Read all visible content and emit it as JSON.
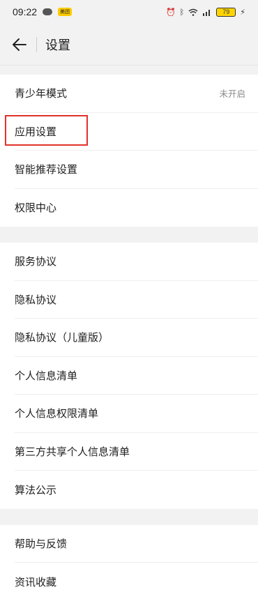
{
  "status_bar": {
    "time": "09:22",
    "app_badge": "美团",
    "battery": "79"
  },
  "header": {
    "title": "设置"
  },
  "sections": [
    {
      "items": [
        {
          "label": "青少年模式",
          "value": "未开启"
        },
        {
          "label": "应用设置"
        },
        {
          "label": "智能推荐设置"
        },
        {
          "label": "权限中心"
        }
      ]
    },
    {
      "items": [
        {
          "label": "服务协议"
        },
        {
          "label": "隐私协议"
        },
        {
          "label": "隐私协议（儿童版）"
        },
        {
          "label": "个人信息清单"
        },
        {
          "label": "个人信息权限清单"
        },
        {
          "label": "第三方共享个人信息清单"
        },
        {
          "label": "算法公示"
        }
      ]
    },
    {
      "items": [
        {
          "label": "帮助与反馈"
        },
        {
          "label": "资讯收藏"
        }
      ]
    }
  ],
  "colors": {
    "highlight": "#e0322b",
    "background": "#f2f2f2"
  }
}
